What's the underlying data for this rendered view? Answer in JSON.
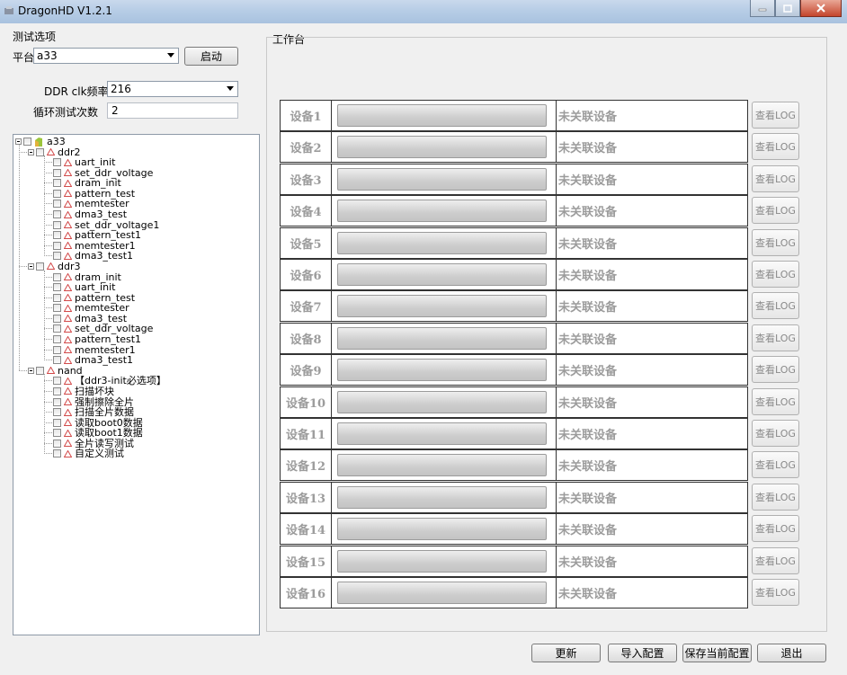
{
  "window": {
    "title": "DragonHD V1.2.1"
  },
  "options": {
    "group_title": "测试选项",
    "platform_label": "平台",
    "platform_value": "a33",
    "start_button": "启动",
    "ddr_clk_label": "DDR clk频率",
    "ddr_clk_value": "216",
    "loop_label": "循环测试次数",
    "loop_value": "2"
  },
  "tree": {
    "root": "a33",
    "groups": [
      {
        "name": "ddr2",
        "items": [
          "uart_init",
          "set_ddr_voltage",
          "dram_init",
          "pattern_test",
          "memtester",
          "dma3_test",
          "set_ddr_voltage1",
          "pattern_test1",
          "memtester1",
          "dma3_test1"
        ]
      },
      {
        "name": "ddr3",
        "items": [
          "dram_init",
          "uart_init",
          "pattern_test",
          "memtester",
          "dma3_test",
          "set_ddr_voltage",
          "pattern_test1",
          "memtester1",
          "dma3_test1"
        ]
      },
      {
        "name": "nand",
        "items": [
          "【ddr3-init必选项】",
          "扫描坏块",
          "强制擦除全片",
          "扫描全片数据",
          "读取boot0数据",
          "读取boot1数据",
          "全片读写测试",
          "自定义测试"
        ]
      }
    ]
  },
  "workbench": {
    "title": "工作台",
    "devices": [
      {
        "name": "设备1",
        "status": "未关联设备",
        "log": "查看LOG"
      },
      {
        "name": "设备2",
        "status": "未关联设备",
        "log": "查看LOG"
      },
      {
        "name": "设备3",
        "status": "未关联设备",
        "log": "查看LOG"
      },
      {
        "name": "设备4",
        "status": "未关联设备",
        "log": "查看LOG"
      },
      {
        "name": "设备5",
        "status": "未关联设备",
        "log": "查看LOG"
      },
      {
        "name": "设备6",
        "status": "未关联设备",
        "log": "查看LOG"
      },
      {
        "name": "设备7",
        "status": "未关联设备",
        "log": "查看LOG"
      },
      {
        "name": "设备8",
        "status": "未关联设备",
        "log": "查看LOG"
      },
      {
        "name": "设备9",
        "status": "未关联设备",
        "log": "查看LOG"
      },
      {
        "name": "设备10",
        "status": "未关联设备",
        "log": "查看LOG"
      },
      {
        "name": "设备11",
        "status": "未关联设备",
        "log": "查看LOG"
      },
      {
        "name": "设备12",
        "status": "未关联设备",
        "log": "查看LOG"
      },
      {
        "name": "设备13",
        "status": "未关联设备",
        "log": "查看LOG"
      },
      {
        "name": "设备14",
        "status": "未关联设备",
        "log": "查看LOG"
      },
      {
        "name": "设备15",
        "status": "未关联设备",
        "log": "查看LOG"
      },
      {
        "name": "设备16",
        "status": "未关联设备",
        "log": "查看LOG"
      }
    ]
  },
  "bottom": {
    "update": "更新",
    "import_config": "导入配置",
    "save_config": "保存当前配置",
    "exit": "退出"
  }
}
